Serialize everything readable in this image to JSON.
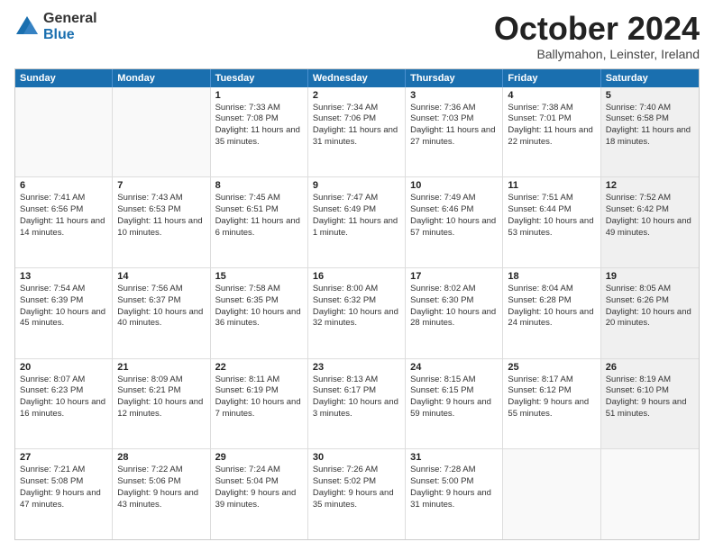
{
  "header": {
    "logo_general": "General",
    "logo_blue": "Blue",
    "month_title": "October 2024",
    "location": "Ballymahon, Leinster, Ireland"
  },
  "weekdays": [
    "Sunday",
    "Monday",
    "Tuesday",
    "Wednesday",
    "Thursday",
    "Friday",
    "Saturday"
  ],
  "weeks": [
    [
      {
        "day": "",
        "sunrise": "",
        "sunset": "",
        "daylight": "",
        "shaded": false,
        "empty": true
      },
      {
        "day": "",
        "sunrise": "",
        "sunset": "",
        "daylight": "",
        "shaded": false,
        "empty": true
      },
      {
        "day": "1",
        "sunrise": "Sunrise: 7:33 AM",
        "sunset": "Sunset: 7:08 PM",
        "daylight": "Daylight: 11 hours and 35 minutes.",
        "shaded": false,
        "empty": false
      },
      {
        "day": "2",
        "sunrise": "Sunrise: 7:34 AM",
        "sunset": "Sunset: 7:06 PM",
        "daylight": "Daylight: 11 hours and 31 minutes.",
        "shaded": false,
        "empty": false
      },
      {
        "day": "3",
        "sunrise": "Sunrise: 7:36 AM",
        "sunset": "Sunset: 7:03 PM",
        "daylight": "Daylight: 11 hours and 27 minutes.",
        "shaded": false,
        "empty": false
      },
      {
        "day": "4",
        "sunrise": "Sunrise: 7:38 AM",
        "sunset": "Sunset: 7:01 PM",
        "daylight": "Daylight: 11 hours and 22 minutes.",
        "shaded": false,
        "empty": false
      },
      {
        "day": "5",
        "sunrise": "Sunrise: 7:40 AM",
        "sunset": "Sunset: 6:58 PM",
        "daylight": "Daylight: 11 hours and 18 minutes.",
        "shaded": true,
        "empty": false
      }
    ],
    [
      {
        "day": "6",
        "sunrise": "Sunrise: 7:41 AM",
        "sunset": "Sunset: 6:56 PM",
        "daylight": "Daylight: 11 hours and 14 minutes.",
        "shaded": false,
        "empty": false
      },
      {
        "day": "7",
        "sunrise": "Sunrise: 7:43 AM",
        "sunset": "Sunset: 6:53 PM",
        "daylight": "Daylight: 11 hours and 10 minutes.",
        "shaded": false,
        "empty": false
      },
      {
        "day": "8",
        "sunrise": "Sunrise: 7:45 AM",
        "sunset": "Sunset: 6:51 PM",
        "daylight": "Daylight: 11 hours and 6 minutes.",
        "shaded": false,
        "empty": false
      },
      {
        "day": "9",
        "sunrise": "Sunrise: 7:47 AM",
        "sunset": "Sunset: 6:49 PM",
        "daylight": "Daylight: 11 hours and 1 minute.",
        "shaded": false,
        "empty": false
      },
      {
        "day": "10",
        "sunrise": "Sunrise: 7:49 AM",
        "sunset": "Sunset: 6:46 PM",
        "daylight": "Daylight: 10 hours and 57 minutes.",
        "shaded": false,
        "empty": false
      },
      {
        "day": "11",
        "sunrise": "Sunrise: 7:51 AM",
        "sunset": "Sunset: 6:44 PM",
        "daylight": "Daylight: 10 hours and 53 minutes.",
        "shaded": false,
        "empty": false
      },
      {
        "day": "12",
        "sunrise": "Sunrise: 7:52 AM",
        "sunset": "Sunset: 6:42 PM",
        "daylight": "Daylight: 10 hours and 49 minutes.",
        "shaded": true,
        "empty": false
      }
    ],
    [
      {
        "day": "13",
        "sunrise": "Sunrise: 7:54 AM",
        "sunset": "Sunset: 6:39 PM",
        "daylight": "Daylight: 10 hours and 45 minutes.",
        "shaded": false,
        "empty": false
      },
      {
        "day": "14",
        "sunrise": "Sunrise: 7:56 AM",
        "sunset": "Sunset: 6:37 PM",
        "daylight": "Daylight: 10 hours and 40 minutes.",
        "shaded": false,
        "empty": false
      },
      {
        "day": "15",
        "sunrise": "Sunrise: 7:58 AM",
        "sunset": "Sunset: 6:35 PM",
        "daylight": "Daylight: 10 hours and 36 minutes.",
        "shaded": false,
        "empty": false
      },
      {
        "day": "16",
        "sunrise": "Sunrise: 8:00 AM",
        "sunset": "Sunset: 6:32 PM",
        "daylight": "Daylight: 10 hours and 32 minutes.",
        "shaded": false,
        "empty": false
      },
      {
        "day": "17",
        "sunrise": "Sunrise: 8:02 AM",
        "sunset": "Sunset: 6:30 PM",
        "daylight": "Daylight: 10 hours and 28 minutes.",
        "shaded": false,
        "empty": false
      },
      {
        "day": "18",
        "sunrise": "Sunrise: 8:04 AM",
        "sunset": "Sunset: 6:28 PM",
        "daylight": "Daylight: 10 hours and 24 minutes.",
        "shaded": false,
        "empty": false
      },
      {
        "day": "19",
        "sunrise": "Sunrise: 8:05 AM",
        "sunset": "Sunset: 6:26 PM",
        "daylight": "Daylight: 10 hours and 20 minutes.",
        "shaded": true,
        "empty": false
      }
    ],
    [
      {
        "day": "20",
        "sunrise": "Sunrise: 8:07 AM",
        "sunset": "Sunset: 6:23 PM",
        "daylight": "Daylight: 10 hours and 16 minutes.",
        "shaded": false,
        "empty": false
      },
      {
        "day": "21",
        "sunrise": "Sunrise: 8:09 AM",
        "sunset": "Sunset: 6:21 PM",
        "daylight": "Daylight: 10 hours and 12 minutes.",
        "shaded": false,
        "empty": false
      },
      {
        "day": "22",
        "sunrise": "Sunrise: 8:11 AM",
        "sunset": "Sunset: 6:19 PM",
        "daylight": "Daylight: 10 hours and 7 minutes.",
        "shaded": false,
        "empty": false
      },
      {
        "day": "23",
        "sunrise": "Sunrise: 8:13 AM",
        "sunset": "Sunset: 6:17 PM",
        "daylight": "Daylight: 10 hours and 3 minutes.",
        "shaded": false,
        "empty": false
      },
      {
        "day": "24",
        "sunrise": "Sunrise: 8:15 AM",
        "sunset": "Sunset: 6:15 PM",
        "daylight": "Daylight: 9 hours and 59 minutes.",
        "shaded": false,
        "empty": false
      },
      {
        "day": "25",
        "sunrise": "Sunrise: 8:17 AM",
        "sunset": "Sunset: 6:12 PM",
        "daylight": "Daylight: 9 hours and 55 minutes.",
        "shaded": false,
        "empty": false
      },
      {
        "day": "26",
        "sunrise": "Sunrise: 8:19 AM",
        "sunset": "Sunset: 6:10 PM",
        "daylight": "Daylight: 9 hours and 51 minutes.",
        "shaded": true,
        "empty": false
      }
    ],
    [
      {
        "day": "27",
        "sunrise": "Sunrise: 7:21 AM",
        "sunset": "Sunset: 5:08 PM",
        "daylight": "Daylight: 9 hours and 47 minutes.",
        "shaded": false,
        "empty": false
      },
      {
        "day": "28",
        "sunrise": "Sunrise: 7:22 AM",
        "sunset": "Sunset: 5:06 PM",
        "daylight": "Daylight: 9 hours and 43 minutes.",
        "shaded": false,
        "empty": false
      },
      {
        "day": "29",
        "sunrise": "Sunrise: 7:24 AM",
        "sunset": "Sunset: 5:04 PM",
        "daylight": "Daylight: 9 hours and 39 minutes.",
        "shaded": false,
        "empty": false
      },
      {
        "day": "30",
        "sunrise": "Sunrise: 7:26 AM",
        "sunset": "Sunset: 5:02 PM",
        "daylight": "Daylight: 9 hours and 35 minutes.",
        "shaded": false,
        "empty": false
      },
      {
        "day": "31",
        "sunrise": "Sunrise: 7:28 AM",
        "sunset": "Sunset: 5:00 PM",
        "daylight": "Daylight: 9 hours and 31 minutes.",
        "shaded": false,
        "empty": false
      },
      {
        "day": "",
        "sunrise": "",
        "sunset": "",
        "daylight": "",
        "shaded": false,
        "empty": true
      },
      {
        "day": "",
        "sunrise": "",
        "sunset": "",
        "daylight": "",
        "shaded": true,
        "empty": true
      }
    ]
  ]
}
